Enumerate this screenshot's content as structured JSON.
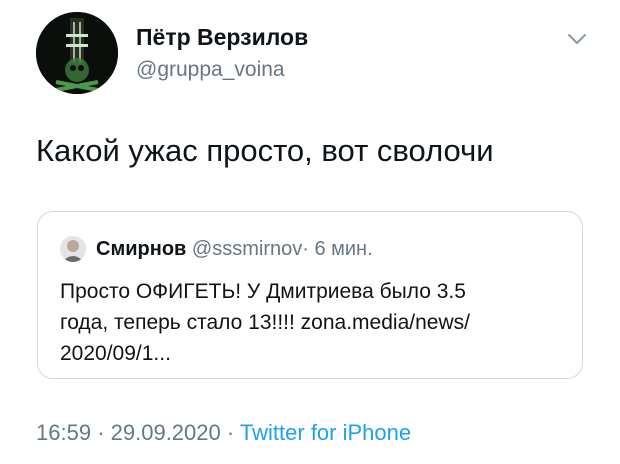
{
  "author": {
    "name": "Пётр Верзилов",
    "handle": "@gruppa_voina"
  },
  "tweet": {
    "text": "Какой ужас просто, вот сволочи"
  },
  "quoted": {
    "name": "Смирнов",
    "handle": "@sssmirnov",
    "separator": "·",
    "time": "6 мин.",
    "text": "Просто ОФИГЕТЬ! У Дмитриева было 3.5\nгода, теперь стало 13!!!! zona.media/news/\n2020/09/1..."
  },
  "meta": {
    "time": "16:59",
    "date": "29.09.2020",
    "separator": "·",
    "source": "Twitter for iPhone"
  },
  "icons": {
    "menu": "chevron-down-icon"
  },
  "colors": {
    "text": "#0f1419",
    "muted": "#657786",
    "link": "#1da1f2",
    "border": "#cfd9de"
  }
}
